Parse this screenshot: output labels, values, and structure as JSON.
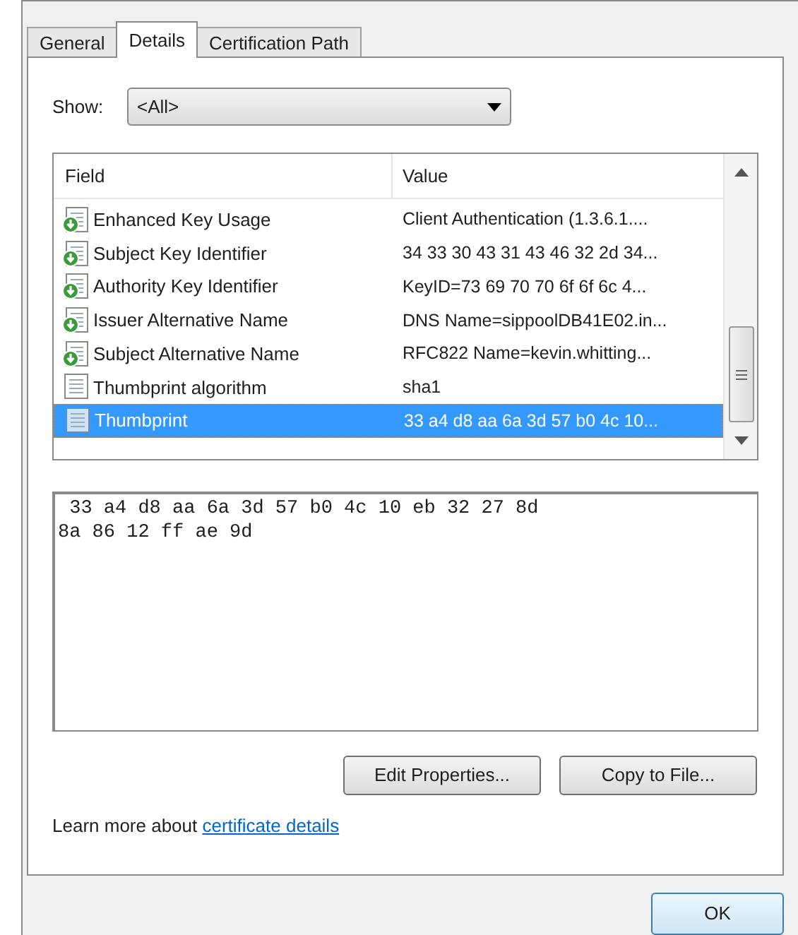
{
  "tabs": [
    {
      "label": "General",
      "selected": false
    },
    {
      "label": "Details",
      "selected": true
    },
    {
      "label": "Certification Path",
      "selected": false
    }
  ],
  "show": {
    "label": "Show:",
    "value": "<All>"
  },
  "table": {
    "columns": [
      "Field",
      "Value"
    ],
    "rows": [
      {
        "kind": "extension",
        "field": "Enhanced Key Usage",
        "value": "Client Authentication (1.3.6.1....",
        "selected": false
      },
      {
        "kind": "extension",
        "field": "Subject Key Identifier",
        "value": "34 33 30 43 31 43 46 32 2d 34...",
        "selected": false
      },
      {
        "kind": "extension",
        "field": "Authority Key Identifier",
        "value": "KeyID=73 69 70 70 6f 6f 6c 4...",
        "selected": false
      },
      {
        "kind": "extension",
        "field": "Issuer Alternative Name",
        "value": "DNS Name=sippoolDB41E02.in...",
        "selected": false
      },
      {
        "kind": "extension",
        "field": "Subject Alternative Name",
        "value": "RFC822 Name=kevin.whitting...",
        "selected": false
      },
      {
        "kind": "property",
        "field": "Thumbprint algorithm",
        "value": "sha1",
        "selected": false
      },
      {
        "kind": "property",
        "field": "Thumbprint",
        "value": "33 a4 d8 aa 6a 3d 57 b0 4c 10...",
        "selected": true
      }
    ]
  },
  "detail_text": " 33 a4 d8 aa 6a 3d 57 b0 4c 10 eb 32 27 8d\n8a 86 12 ff ae 9d",
  "buttons": [
    "Edit Properties...",
    "Copy to File..."
  ],
  "learn_more": {
    "text": "Learn more about",
    "link": "certificate details"
  },
  "ok_button": "OK"
}
